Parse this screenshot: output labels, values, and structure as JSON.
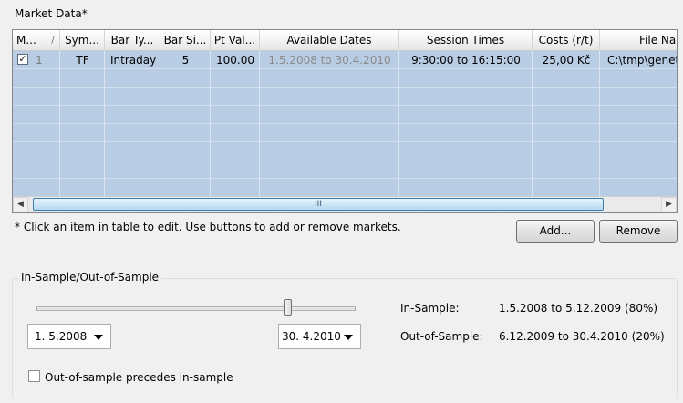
{
  "market_data": {
    "title": "Market Data*",
    "columns": [
      "M...",
      "Sym...",
      "Bar Ty...",
      "Bar Si...",
      "Pt Val...",
      "Available Dates",
      "Session Times",
      "Costs (r/t)",
      "File Na"
    ],
    "sort_indicator": "/",
    "rows": [
      {
        "checked": true,
        "index": "1",
        "symbol": "TF",
        "bar_type": "Intraday",
        "bar_size": "5",
        "pt_value": "100.00",
        "available_dates": "1.5.2008 to 30.4.2010",
        "session_times": "9:30:00 to 16:15:00",
        "costs": "25,00 Kč",
        "file_name": "C:\\tmp\\genet"
      }
    ],
    "scroll_grip": "III",
    "note": "* Click an item in table to edit. Use buttons to add or remove markets.",
    "add_label": "Add...",
    "remove_label": "Remove"
  },
  "sample": {
    "group_label": "In-Sample/Out-of-Sample",
    "slider_value": 0.8,
    "start_date": "1.  5.2008",
    "end_date": "30.  4.2010",
    "in_sample_label": "In-Sample:",
    "in_sample_value": "1.5.2008 to 5.12.2009 (80%)",
    "out_sample_label": "Out-of-Sample:",
    "out_sample_value": "6.12.2009 to 30.4.2010 (20%)",
    "precedes_label": "Out-of-sample precedes in-sample",
    "precedes_checked": false
  }
}
